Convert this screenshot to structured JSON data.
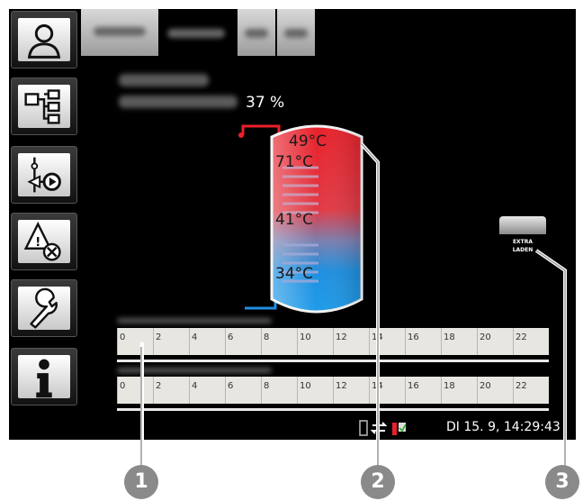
{
  "sidebar": {
    "items": [
      {
        "name": "user"
      },
      {
        "name": "system-overview"
      },
      {
        "name": "circuit-pump"
      },
      {
        "name": "alarms"
      },
      {
        "name": "service"
      },
      {
        "name": "info"
      }
    ]
  },
  "tank": {
    "level_percent": "37 %",
    "level_value": 37,
    "temp_top": "49°C",
    "temp_upper": "71°C",
    "temp_middle": "41°C",
    "temp_bottom": "34°C"
  },
  "extra_button": {
    "line1": "EXTRA",
    "line2": "LADEN"
  },
  "timeline": {
    "ticks": [
      "0",
      "2",
      "4",
      "6",
      "8",
      "10",
      "12",
      "14",
      "16",
      "18",
      "20",
      "22"
    ]
  },
  "status_bar": {
    "datetime": "DI 15. 9, 14:29:43"
  },
  "callouts": [
    "1",
    "2",
    "3"
  ],
  "colors": {
    "hot": "#e8202a",
    "cold": "#1e8fe0",
    "screen_bg": "#000000",
    "callout": "#8a8a8a"
  }
}
